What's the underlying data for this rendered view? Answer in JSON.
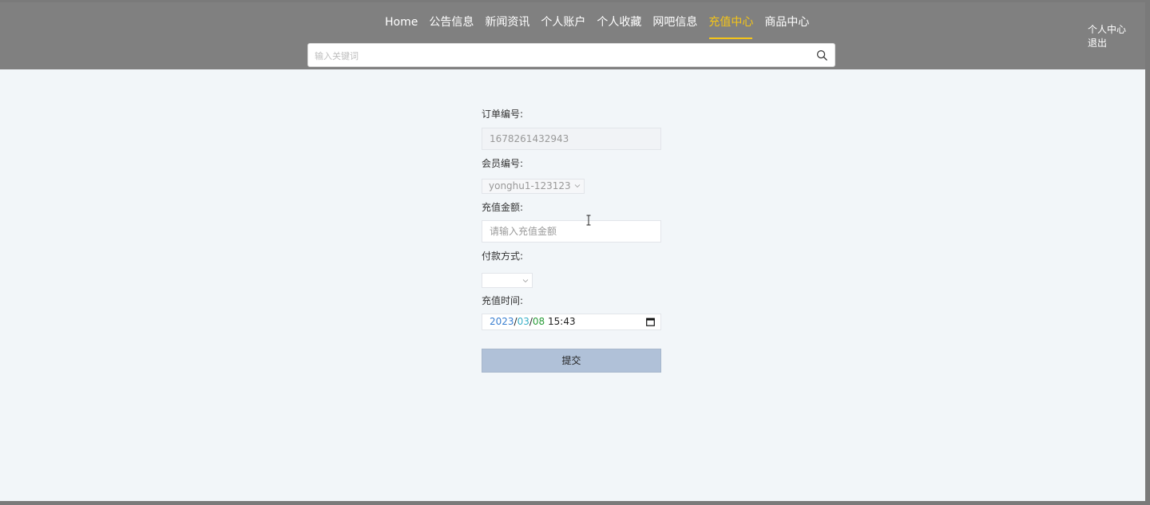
{
  "nav": {
    "items": [
      {
        "label": "Home"
      },
      {
        "label": "公告信息"
      },
      {
        "label": "新闻资讯"
      },
      {
        "label": "个人账户"
      },
      {
        "label": "个人收藏"
      },
      {
        "label": "网吧信息"
      },
      {
        "label": "充值中心",
        "active": true
      },
      {
        "label": "商品中心"
      }
    ],
    "active_color": "#f5c518"
  },
  "search": {
    "placeholder": "输入关键词",
    "icon": "search-icon"
  },
  "user_links": {
    "profile": "个人中心",
    "logout": "退出"
  },
  "form": {
    "order_no": {
      "label": "订单编号:",
      "value": "1678261432943"
    },
    "member_no": {
      "label": "会员编号:",
      "value": "yonghu1-123123"
    },
    "amount": {
      "label": "充值金额:",
      "placeholder": "请输入充值金额"
    },
    "payment": {
      "label": "付款方式:",
      "value": ""
    },
    "time": {
      "label": "充值时间:",
      "year": "2023",
      "month": "03",
      "day": "08",
      "time": "15:43"
    },
    "submit_label": "提交"
  }
}
